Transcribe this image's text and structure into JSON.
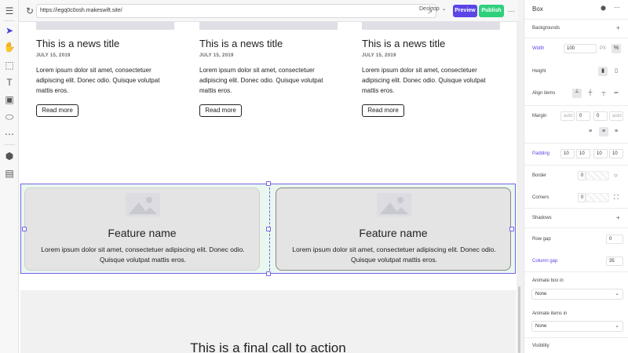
{
  "toolbar": {
    "url": "https://iegq0c0osh.makeswift.site/",
    "device": "Desktop",
    "preview_label": "Preview",
    "publish_label": "Publish",
    "more_glyph": "⋯",
    "reload_glyph": "↻",
    "external_glyph": "↗"
  },
  "tools": {
    "panel_toggle": "☰",
    "select": "➤",
    "hand": "✋",
    "box": "⬚",
    "text": "T",
    "image": "▣",
    "button": "⬭",
    "more": "⋯",
    "components": "⬢",
    "layout": "▤"
  },
  "news": [
    {
      "title": "This is a news title",
      "date": "JULY 15, 2019",
      "body": "Lorem ipsum dolor sit amet, consectetuer adipiscing elit. Donec odio. Quisque volutpat mattis eros.",
      "button": "Read more"
    },
    {
      "title": "This is a news title",
      "date": "JULY 15, 2019",
      "body": "Lorem ipsum dolor sit amet, consectetuer adipiscing elit. Donec odio. Quisque volutpat mattis eros.",
      "button": "Read more"
    },
    {
      "title": "This is a news title",
      "date": "JULY 15, 2019",
      "body": "Lorem ipsum dolor sit amet, consectetuer adipiscing elit. Donec odio. Quisque volutpat mattis eros.",
      "button": "Read more"
    }
  ],
  "features": [
    {
      "title": "Feature name",
      "body": "Lorem ipsum dolor sit amet, consectetuer adipiscing elit. Donec odio. Quisque volutpat mattis eros."
    },
    {
      "title": "Feature name",
      "body": "Lorem ipsum dolor sit amet, consectetuer adipiscing elit. Donec odio. Quisque volutpat mattis eros."
    }
  ],
  "final_cta": "This is a final call to action",
  "panel": {
    "title": "Box",
    "backgrounds": "Backgrounds",
    "width_label": "Width",
    "width_value": "100",
    "width_unit_px": "PX",
    "width_unit_pct": "%",
    "height_label": "Height",
    "align_items_label": "Align items",
    "margin_label": "Margin",
    "margin_values": [
      "auto",
      "0",
      "0",
      "auto"
    ],
    "padding_label": "Padding",
    "padding_values": [
      "10",
      "10",
      "10",
      "10"
    ],
    "border_label": "Border",
    "border_value": "0",
    "corners_label": "Corners",
    "corners_value": "0",
    "shadows_label": "Shadows",
    "row_gap_label": "Row gap",
    "row_gap_value": "0",
    "column_gap_label": "Column gap",
    "column_gap_value": "35",
    "animate_box_label": "Animate box in",
    "animate_box_value": "None",
    "animate_items_label": "Animate items in",
    "animate_items_value": "None",
    "visibility_label": "Visibility",
    "plus_glyph": "+",
    "more_glyph": "⋯",
    "chevron": "⌄",
    "accent_color": "#5b45e6"
  }
}
